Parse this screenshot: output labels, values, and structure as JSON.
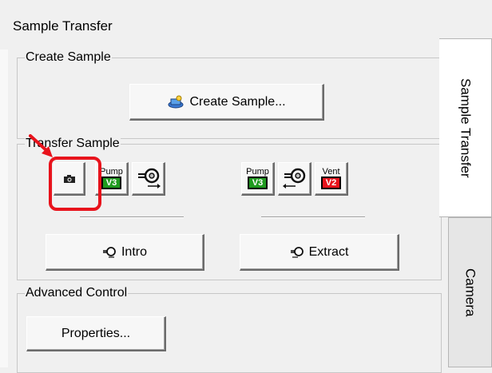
{
  "window": {
    "title": "Sample Transfer"
  },
  "groups": {
    "create": {
      "label": "Create Sample",
      "button_label": "Create Sample..."
    },
    "transfer": {
      "label": "Transfer Sample",
      "intro_label": "Intro",
      "extract_label": "Extract",
      "icons_left": [
        {
          "name": "camera-icon"
        },
        {
          "name": "pump-v3",
          "top": "Pump",
          "badge": "V3",
          "badge_color": "#1f9b1f"
        },
        {
          "name": "intro-transfer-icon"
        }
      ],
      "icons_right": [
        {
          "name": "pump-v3",
          "top": "Pump",
          "badge": "V3",
          "badge_color": "#1f9b1f"
        },
        {
          "name": "extract-transfer-icon"
        },
        {
          "name": "vent-v2",
          "top": "Vent",
          "badge": "V2",
          "badge_color": "#e8131c"
        }
      ]
    },
    "advanced": {
      "label": "Advanced Control",
      "properties_label": "Properties..."
    }
  },
  "tabs": [
    {
      "label": "Sample Transfer",
      "active": true
    },
    {
      "label": "Camera",
      "active": false
    }
  ],
  "colors": {
    "highlight": "#e8131c",
    "pump_green": "#1f9b1f",
    "vent_red": "#e8131c"
  }
}
